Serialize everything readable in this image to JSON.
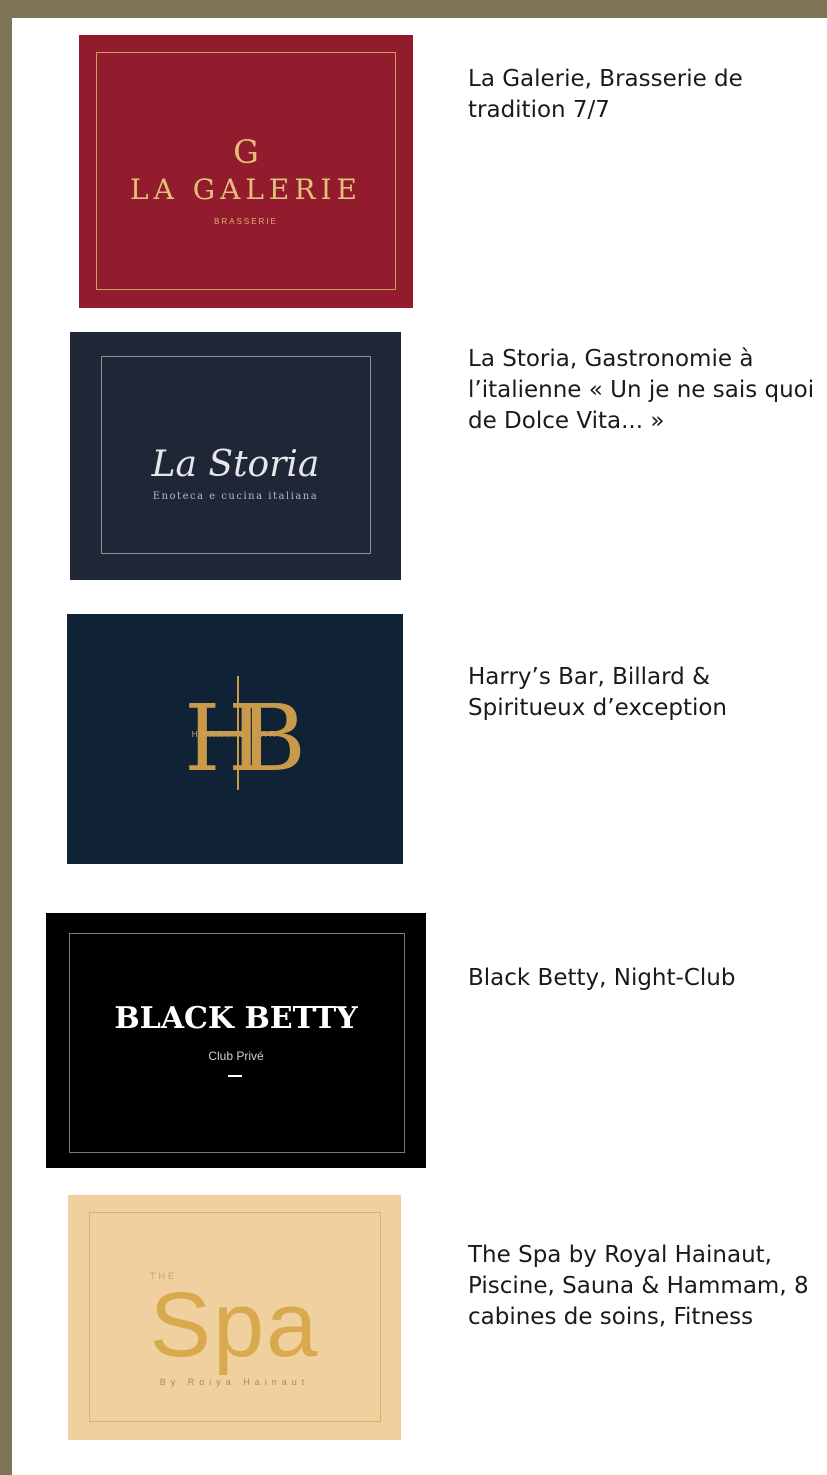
{
  "colors": {
    "frame": "#7d7556",
    "galerie_bg": "#921b2d",
    "storia_bg": "#1f2636",
    "harrys_bg": "#0f2236",
    "betty_bg": "#000000",
    "spa_bg": "#efd09e",
    "gold": "#d8b36a"
  },
  "venues": [
    {
      "logo": {
        "mark": "G",
        "name": "LA GALERIE",
        "sub": "BRASSERIE"
      },
      "caption": " La Galerie, Brasserie de tradition 7/7"
    },
    {
      "logo": {
        "name": "La Storia",
        "sub": "Enoteca e cucina italiana"
      },
      "caption": " La Storia, Gastronomie à l’italienne « Un je ne sais quoi de Dolce Vita... »"
    },
    {
      "logo": {
        "mark": "HB",
        "sub": "HARRY'S BAR"
      },
      "caption": " Harry’s Bar, Billard & Spiritueux d’exception"
    },
    {
      "logo": {
        "name": "BLACK BETTY",
        "sub": "Club Privé"
      },
      "caption": " Black Betty, Night-Club"
    },
    {
      "logo": {
        "pre": "THE",
        "name": "Spa",
        "sub": "By Roiya Hainaut"
      },
      "caption": " The Spa by Royal Hainaut, Piscine, Sauna & Hammam, 8 cabines de soins, Fitness"
    }
  ]
}
